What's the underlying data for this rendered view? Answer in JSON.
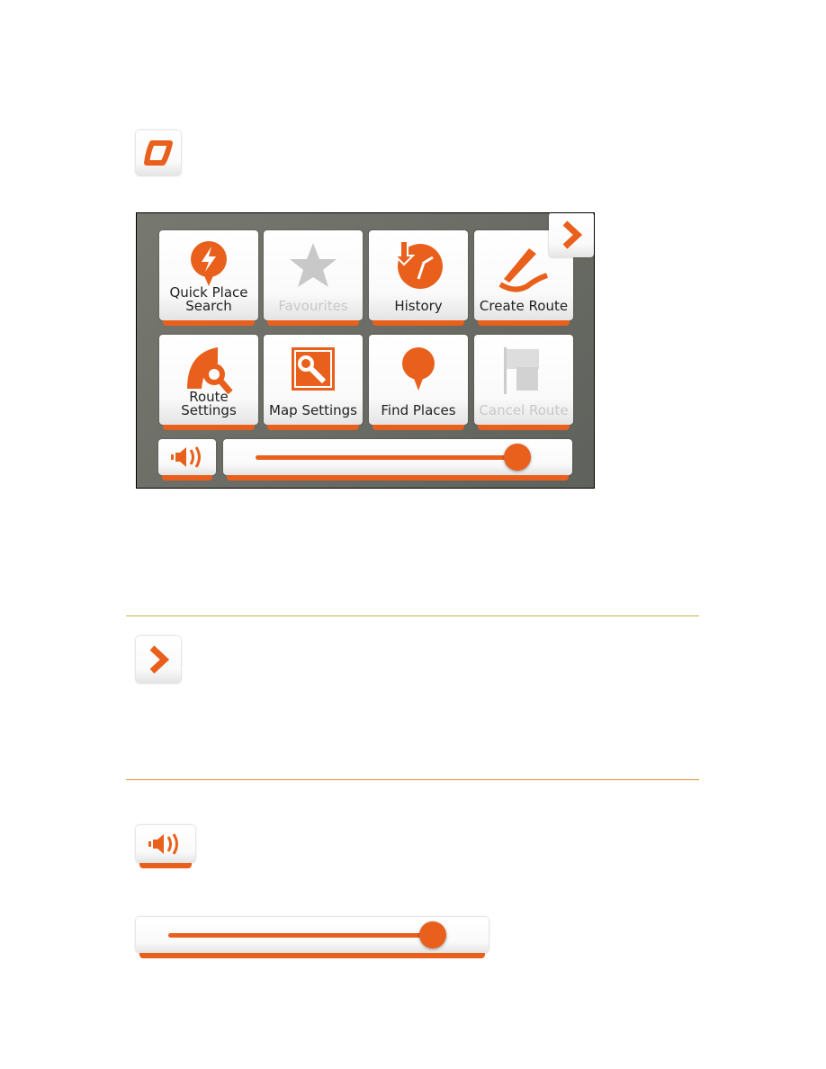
{
  "menu": {
    "tiles": [
      {
        "label_line1": "Quick Place",
        "label_line2": "Search",
        "icon": "quick-search-icon",
        "enabled": true
      },
      {
        "label": "Favourites",
        "icon": "star-icon",
        "enabled": false
      },
      {
        "label": "History",
        "icon": "history-icon",
        "enabled": true
      },
      {
        "label": "Create Route",
        "icon": "create-route-icon",
        "enabled": true
      },
      {
        "label_line1": "Route",
        "label_line2": "Settings",
        "icon": "route-settings-icon",
        "enabled": true
      },
      {
        "label": "Map Settings",
        "icon": "map-settings-icon",
        "enabled": true
      },
      {
        "label": "Find Places",
        "icon": "pin-icon",
        "enabled": true
      },
      {
        "label": "Cancel Route",
        "icon": "checkered-flag-icon",
        "enabled": false
      }
    ],
    "volume_level": 0.92
  },
  "standalone": {
    "volume_level": 0.92
  },
  "colors": {
    "accent": "#e8601c",
    "divider_top": "#c9b24a",
    "divider_bottom": "#e8902c"
  }
}
